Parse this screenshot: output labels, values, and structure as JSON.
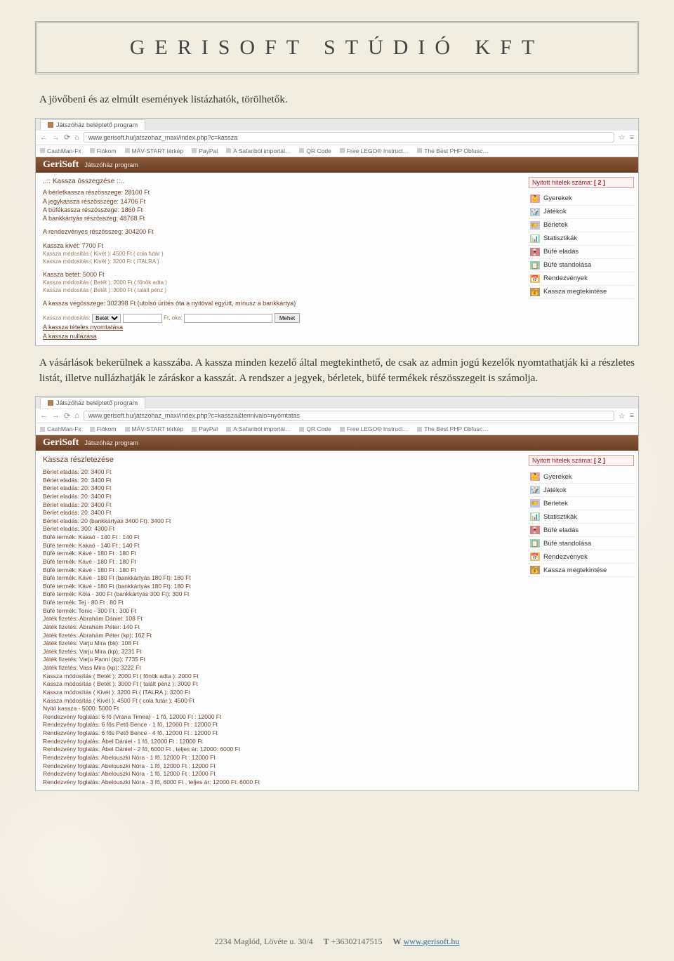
{
  "doc": {
    "title": "GERISOFT STÚDIÓ KFT",
    "para1": "A jövőbeni és az elmúlt események listázhatók, törölhetők.",
    "para2": "A vásárlások bekerülnek a kasszába. A kassza minden kezelő által megtekinthető, de csak az admin jogú kezelők nyomtathatják ki a részletes listát, illetve nullázhatják le záráskor a kasszát. A rendszer a jegyek, bérletek, büfé termékek részösszegeit is számolja."
  },
  "browser": {
    "tab_title": "Játszóház beléptető program",
    "bookmarks": [
      "CashMan-Fx",
      "Fiókom",
      "MÁV-START térkép",
      "PayPal",
      "A Safariból importál…",
      "QR Code",
      "Free LEGO® Instruct…",
      "The Best PHP Obfusc…"
    ]
  },
  "app": {
    "brand": "GeriSoft",
    "subtitle": "Játszóház program"
  },
  "sidebar": {
    "credits_label": "Nyitott hitelek száma:",
    "credits_count": "[ 2 ]",
    "items": [
      {
        "label": "Gyerekek",
        "color": "#e8a0a0",
        "icon": "👶"
      },
      {
        "label": "Játékok",
        "color": "#b0d0e8",
        "icon": "🎲"
      },
      {
        "label": "Bérletek",
        "color": "#c0c0f0",
        "icon": "🎫"
      },
      {
        "label": "Statisztikák",
        "color": "#a0e0a0",
        "icon": "📊"
      },
      {
        "label": "Büfé eladás",
        "color": "#d08080",
        "icon": "🍷"
      },
      {
        "label": "Büfé standolása",
        "color": "#a0d0b0",
        "icon": "📋"
      },
      {
        "label": "Rendezvények",
        "color": "#f0c060",
        "icon": "📅"
      },
      {
        "label": "Kassza megtekintése",
        "color": "#c09060",
        "icon": "💰"
      }
    ]
  },
  "shot1": {
    "url": "www.gerisoft.hu/jatszohaz_maxi/index.php?c=kassza",
    "section_title": "..:: Kassza összegzése ::..",
    "lines1": [
      "A bérletkassza részösszege: 28100 Ft",
      "A jegykassza részösszege: 14706 Ft",
      "A büfékassza részösszege: 1860 Ft",
      "A bankkártyás részösszeg: 48768 Ft"
    ],
    "lines2": [
      "A rendezvényes részösszeg: 304200 Ft"
    ],
    "lines3_head": "Kassza kivét: 7700 Ft",
    "lines3": [
      "Kassza módosítás ( Kivét ): 4500 Ft ( cola futár )",
      "Kassza módosítás ( Kivét ): 3200 Ft ( ITALRA )"
    ],
    "lines4_head": "Kassza betét: 5000 Ft",
    "lines4": [
      "Kassza módosítás ( Betét ): 2000 Ft ( főnök adta )",
      "Kassza módosítás ( Betét ): 3000 Ft ( talált pénz )"
    ],
    "total": "A kassza végösszege: 302398 Ft (utolsó ürítés óta a nyitóval együtt, mínusz a bankkártya)",
    "mod_label": "Kassza módosítás:",
    "mod_select": "Betét",
    "mod_ft": "Ft, oka:",
    "mod_btn": "Mehet",
    "print_link": "A kassza tételes nyomtatása",
    "reset_link": "A kassza nullázása"
  },
  "shot2": {
    "url": "www.gerisoft.hu/jatszohaz_maxi/index.php?c=kassza&tennivalo=nyomtatas",
    "section_title": "Kassza részletezése",
    "lines": [
      "Bérlet eladás: 20: 3400 Ft",
      "Bérlet eladás: 20: 3400 Ft",
      "Bérlet eladás: 20: 3400 Ft",
      "Bérlet eladás: 20: 3400 Ft",
      "Bérlet eladás: 20: 3400 Ft",
      "Bérlet eladás: 20: 3400 Ft",
      "Bérlet eladás: 20 (bankkártyás 3400 Ft): 3400 Ft",
      "Bérlet eladás: 300: 4300 Ft",
      "Büfé termék: Kakaó - 140 Ft : 140 Ft",
      "Büfé termék: Kakaó - 140 Ft : 140 Ft",
      "Büfé termék: Kávé - 180 Ft : 180 Ft",
      "Büfé termék: Kávé - 180 Ft : 180 Ft",
      "Büfé termék: Kávé - 180 Ft : 180 Ft",
      "Büfé termék: Kávé - 180 Ft (bankkártyás 180 Ft): 180 Ft",
      "Büfé termék: Kávé - 180 Ft (bankkártyás 180 Ft): 180 Ft",
      "Büfé termék: Kóla - 300 Ft (bankkártyás 300 Ft): 300 Ft",
      "Büfé termék: Tej - 80 Ft : 80 Ft",
      "Büfé termék: Tonic - 300 Ft : 300 Ft",
      "Játék fizetés: Ábrahám Dániel: 108 Ft",
      "Játék fizetés: Ábrahám Péter: 140 Ft",
      "Játék fizetés: Ábrahám Péter (kp): 162 Ft",
      "Játék fizetés: Varju Mira (bk): 108 Ft",
      "Játék fizetés: Varju Mira (kp): 3231 Ft",
      "Játék fizetés: Varju Panni (kp): 7735 Ft",
      "Játék fizetés: Vass Mira (kp): 3222 Ft",
      "Kassza módosítás ( Betét ): 2000 Ft ( főnök adta ): 2000 Ft",
      "Kassza módosítás ( Betét ): 3000 Ft ( talált pénz ): 3000 Ft",
      "Kassza módosítás ( Kivét ): 3200 Ft ( ITALRA ): 3200 Ft",
      "Kassza módosítás ( Kivét ): 4500 Ft ( cola futár ): 4500 Ft",
      "Nyitó kassza - 5000: 5000 Ft",
      "Rendezvény foglalás: 6 fő (Vrana Timea) - 1 fő, 12000 Ft : 12000 Ft",
      "Rendezvény foglalás: 6 fős Pető Bence - 1 fő, 12000 Ft : 12000 Ft",
      "Rendezvény foglalás: 6 fős Pető Bence - 4 fő, 12000 Ft : 12000 Ft",
      "Rendezvény foglalás: Ábel Dániel - 1 fő, 12000 Ft : 12000 Ft",
      "Rendezvény foglalás: Ábel Dániel - 2 fő, 6000 Ft , teljes ár: 12000: 6000 Ft",
      "Rendezvény foglalás: Abelouszki Nóra - 1 fő, 12000 Ft : 12000 Ft",
      "Rendezvény foglalás: Abelouszki Nóra - 1 fő, 12000 Ft : 12000 Ft",
      "Rendezvény foglalás: Abelouszki Nóra - 1 fő, 12000 Ft : 12000 Ft",
      "Rendezvény foglalás: Abelouszki Nóra - 3 fő, 6000 Ft , teljes ár: 12000 Ft: 6000 Ft"
    ]
  },
  "footer": {
    "address": "2234 Maglód, Lövéte u. 30/4",
    "phone_label": "T",
    "phone": "+36302147515",
    "web_label": "W",
    "web": "www.gerisoft.hu"
  }
}
